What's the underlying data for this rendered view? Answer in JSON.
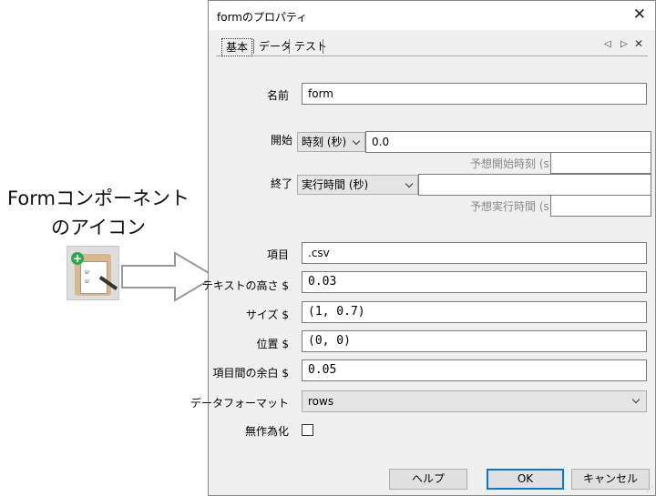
{
  "annotation": {
    "line1": "Formコンポーネント",
    "line2": "のアイコン",
    "icon_text_1": "sr",
    "icon_text_2": "sr",
    "plus": "+"
  },
  "dialog": {
    "title": "formのプロパティ",
    "close": "✕",
    "tabs": [
      "基本",
      "データ",
      "テスト"
    ],
    "tab_nav": {
      "left": "◁",
      "right": "▷",
      "close": "✕"
    }
  },
  "form": {
    "name": {
      "label": "名前",
      "value": "form"
    },
    "start": {
      "label": "開始",
      "type": "時刻 (秒)",
      "value": "0.0",
      "expected_label": "予想開始時刻 (s)",
      "expected_value": ""
    },
    "stop": {
      "label": "終了",
      "type": "実行時間 (秒)",
      "value": "",
      "expected_label": "予想実行時間 (s)",
      "expected_value": ""
    },
    "items": {
      "label": "項目",
      "value": ".csv"
    },
    "text_height": {
      "label": "テキストの高さ $",
      "value": "0.03"
    },
    "size": {
      "label": "サイズ $",
      "value": "(1, 0.7)"
    },
    "position": {
      "label": "位置 $",
      "value": "(0, 0)"
    },
    "item_padding": {
      "label": "項目間の余白 $",
      "value": "0.05"
    },
    "data_format": {
      "label": "データフォーマット",
      "value": "rows"
    },
    "randomize": {
      "label": "無作為化",
      "checked": false
    }
  },
  "buttons": {
    "help": "ヘルプ",
    "ok": "OK",
    "cancel": "キャンセル"
  },
  "colors": {
    "accent": "#0078d7",
    "dialog_bg": "#f0f0f0"
  }
}
